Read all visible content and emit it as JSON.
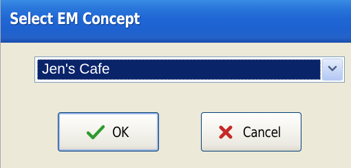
{
  "window": {
    "title": "Select EM Concept"
  },
  "concept_select": {
    "selected_value": "Jen's Cafe"
  },
  "buttons": {
    "ok_label": "OK",
    "cancel_label": "Cancel"
  },
  "icons": {
    "combo_arrow": "chevron-down-icon",
    "ok": "checkmark-icon",
    "cancel": "x-mark-icon"
  },
  "colors": {
    "titlebar": "#1f66d4",
    "selection": "#0a246a",
    "ok_icon": "#2e9a2e",
    "cancel_icon": "#c62828"
  }
}
